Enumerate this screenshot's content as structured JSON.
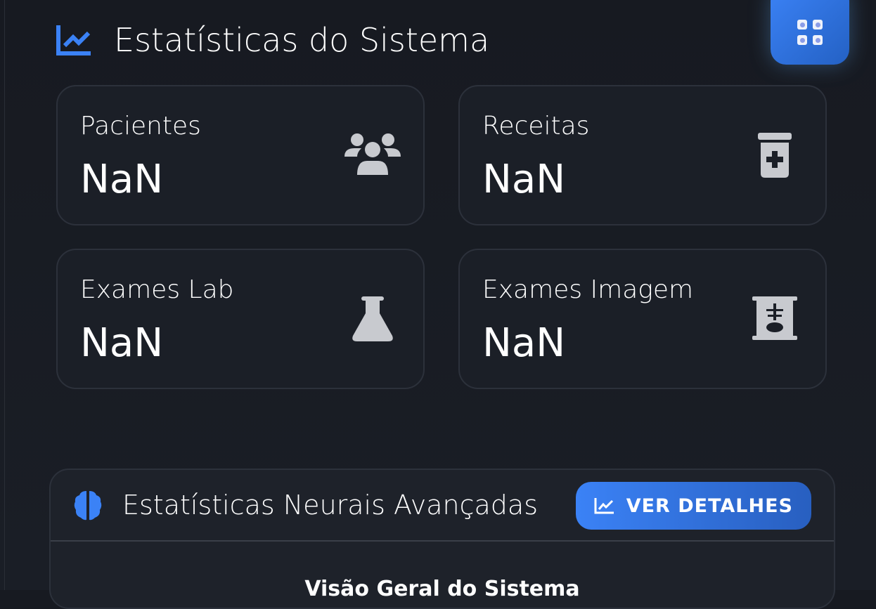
{
  "header": {
    "title": "Estatísticas do Sistema"
  },
  "stats": [
    {
      "label": "Pacientes",
      "value": "NaN",
      "icon": "users-icon"
    },
    {
      "label": "Receitas",
      "value": "NaN",
      "icon": "prescription-bottle-icon"
    },
    {
      "label": "Exames Lab",
      "value": "NaN",
      "icon": "flask-icon"
    },
    {
      "label": "Exames Imagem",
      "value": "NaN",
      "icon": "x-ray-icon"
    }
  ],
  "neural": {
    "title": "Estatísticas Neurais Avançadas",
    "button": "VER DETALHES",
    "subtitle": "Visão Geral do Sistema"
  },
  "colors": {
    "accent": "#3b82f6"
  }
}
